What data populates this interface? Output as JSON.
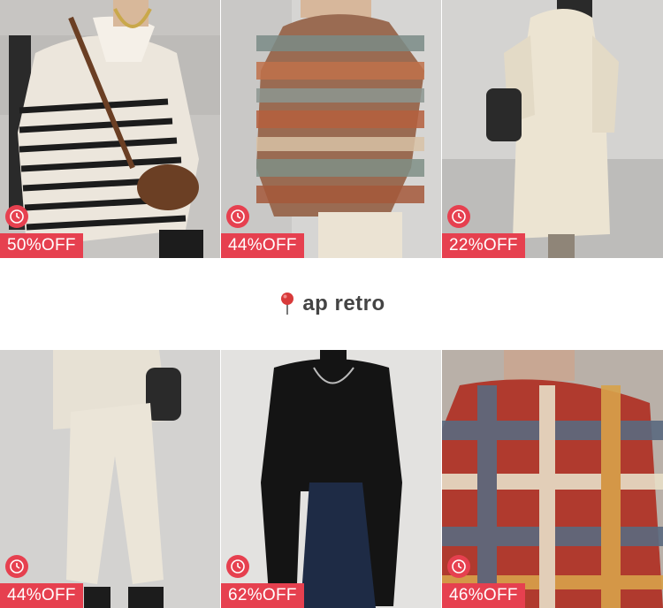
{
  "products_top": [
    {
      "discount": "50%OFF",
      "icon": "clock-icon"
    },
    {
      "discount": "44%OFF",
      "icon": "clock-icon"
    },
    {
      "discount": "22%OFF",
      "icon": "clock-icon"
    }
  ],
  "store": {
    "name": "ap retro",
    "icon": "map-pin-icon"
  },
  "products_bottom": [
    {
      "discount": "44%OFF",
      "icon": "clock-icon"
    },
    {
      "discount": "62%OFF",
      "icon": "clock-icon"
    },
    {
      "discount": "46%OFF",
      "icon": "clock-icon"
    }
  ],
  "colors": {
    "badge": "#e6404f",
    "store_text": "#444444",
    "pin": "#d83a3a"
  }
}
